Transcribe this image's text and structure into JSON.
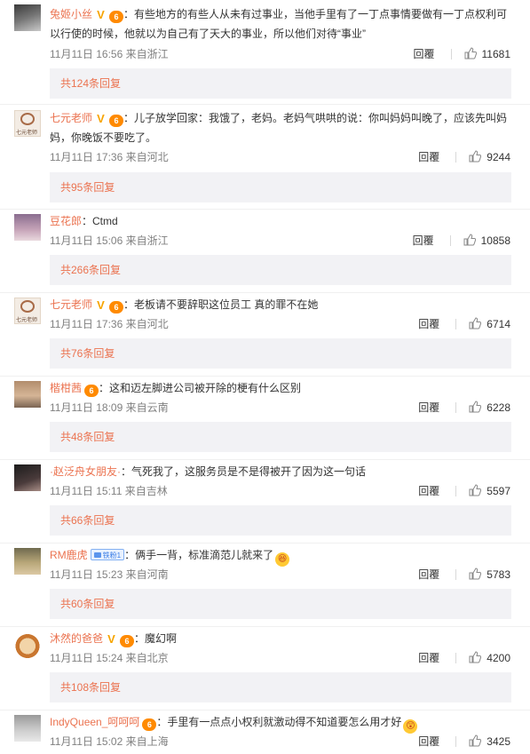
{
  "comments": [
    {
      "username": "兔姬小丝",
      "verified": true,
      "vip": true,
      "fan_badge": "",
      "text": "：有些地方的有些人从未有过事业，当他手里有了一丁点事情要做有一丁点权利可以行使的时候，他就以为自己有了天大的事业，所以他们对待“事业”",
      "emoji": "",
      "time": "11月11日 16:56",
      "location": "来自浙江",
      "reply_label": "回覆",
      "likes": "11681",
      "replies_link": "共124条回复",
      "avatar_icon": "user-avatar"
    },
    {
      "username": "七元老师",
      "verified": true,
      "vip": true,
      "fan_badge": "",
      "text": "：儿子放学回家：我饿了，老妈。老妈气哄哄的说：你叫妈妈叫晚了，应该先叫妈妈，你晚饭不要吃了。",
      "emoji": "",
      "time": "11月11日 17:36",
      "location": "来自河北",
      "reply_label": "回覆",
      "likes": "9244",
      "replies_link": "共95条回复",
      "avatar_icon": "user-avatar"
    },
    {
      "username": "豆花郎",
      "verified": false,
      "vip": false,
      "fan_badge": "",
      "text": "：Ctmd",
      "emoji": "",
      "time": "11月11日 15:06",
      "location": "来自浙江",
      "reply_label": "回覆",
      "likes": "10858",
      "replies_link": "共266条回复",
      "avatar_icon": "user-avatar"
    },
    {
      "username": "七元老师",
      "verified": true,
      "vip": true,
      "fan_badge": "",
      "text": "：老板请不要辞职这位员工 真的罪不在她",
      "emoji": "",
      "time": "11月11日 17:36",
      "location": "来自河北",
      "reply_label": "回覆",
      "likes": "6714",
      "replies_link": "共76条回复",
      "avatar_icon": "user-avatar"
    },
    {
      "username": "楷柑茜",
      "verified": false,
      "vip": true,
      "fan_badge": "",
      "text": "：这和迈左脚进公司被开除的梗有什么区别",
      "emoji": "",
      "time": "11月11日 18:09",
      "location": "来自云南",
      "reply_label": "回覆",
      "likes": "6228",
      "replies_link": "共48条回复",
      "avatar_icon": "user-avatar"
    },
    {
      "username": "·赵泛舟女朋友·",
      "verified": false,
      "vip": false,
      "fan_badge": "",
      "text": "：气死我了，这服务员是不是得被开了因为这一句话",
      "emoji": "",
      "time": "11月11日 15:11",
      "location": "来自吉林",
      "reply_label": "回覆",
      "likes": "5597",
      "replies_link": "共66条回复",
      "avatar_icon": "user-avatar"
    },
    {
      "username": "RM鹿虎",
      "verified": false,
      "vip": false,
      "fan_badge": "铁粉1",
      "text": "：俩手一背，标准滴范儿就来了",
      "emoji": "😆",
      "time": "11月11日 15:23",
      "location": "来自河南",
      "reply_label": "回覆",
      "likes": "5783",
      "replies_link": "共60条回复",
      "avatar_icon": "user-avatar"
    },
    {
      "username": "沐然的爸爸",
      "verified": true,
      "vip": true,
      "fan_badge": "",
      "text": "：魔幻啊",
      "emoji": "",
      "time": "11月11日 15:24",
      "location": "来自北京",
      "reply_label": "回覆",
      "likes": "4200",
      "replies_link": "共108条回复",
      "avatar_icon": "user-avatar"
    },
    {
      "username": "IndyQueen_呵呵呵",
      "verified": false,
      "vip": true,
      "fan_badge": "",
      "text": "：手里有一点点小权利就激动得不知道要怎么用才好",
      "emoji": "😲",
      "time": "11月11日 15:02",
      "location": "来自上海",
      "reply_label": "回覆",
      "likes": "3425",
      "replies_link": "",
      "avatar_icon": "user-avatar"
    }
  ],
  "seal_text": "七元老师",
  "colors": {
    "username": "#eb7350",
    "meta": "#808080",
    "replies_bg": "#f2f2f5"
  }
}
